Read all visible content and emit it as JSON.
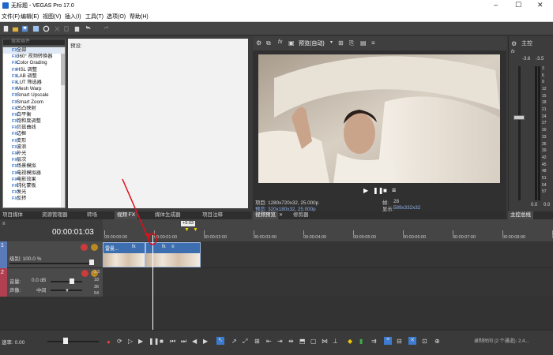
{
  "window": {
    "title": "无标题 - VEGAS Pro 17.0"
  },
  "menu": [
    "文件(F)",
    "编辑(E)",
    "视图(V)",
    "插入(I)",
    "工具(T)",
    "选项(O)",
    "帮助(H)"
  ],
  "explorer": {
    "search_placeholder": "搜索插件",
    "presets_label": "预设:",
    "fx_items": [
      "全部",
      "360° 视频转换器",
      "Color Grading",
      "HSL 调整",
      "LAB 调整",
      "LUT 筛选器",
      "Mesh Warp",
      "Smart Upscale",
      "Smart Zoom",
      "凹凸映射",
      "白平衡",
      "饱和度调整",
      "贝兹曲线",
      "边框",
      "变形",
      "波浪",
      "补光",
      "层次",
      "场景模拟",
      "电视模拟器",
      "电影效果",
      "钝化蒙板",
      "发光",
      "反转"
    ]
  },
  "bottom_tabs": [
    "项目媒体",
    "资源管理器",
    "转场",
    "视频 FX",
    "媒体生成器",
    "项目注释"
  ],
  "preview": {
    "quality": "预览(自动)",
    "project_info": "项目: 1280x720x32, 25.000p",
    "preview_info": "预览: 320x180x32, 25.000p",
    "frame_label": "帧:",
    "frame_value": "28",
    "display_label": "显示:",
    "display_value": "589x332x32",
    "tabs": [
      "视频预览",
      "修剪器"
    ]
  },
  "master": {
    "title": "主控",
    "levels": [
      "-3.6",
      "-3.5"
    ],
    "scale": [
      "3",
      "6",
      "9",
      "12",
      "15",
      "18",
      "21",
      "24",
      "27",
      "30",
      "33",
      "36",
      "39",
      "42",
      "45",
      "48",
      "51",
      "54",
      "57"
    ],
    "bottom_values": [
      "0.0",
      "0.0"
    ],
    "bus_label": "主控总线"
  },
  "timeline": {
    "timecode": "00:00:01:03",
    "cursor_box": "+5:03",
    "ruler": [
      "00:00:00:00",
      "00:00:01:00",
      "00:00:02:00",
      "00:00:03:00",
      "00:00:04:00",
      "00:00:05:00",
      "00:00:06:00",
      "00:00:07:00",
      "00:00:08:00",
      "00:00:09:00"
    ],
    "video_track": {
      "number": "1",
      "level_label": "级别: 100.0 %"
    },
    "audio_track": {
      "number": "2",
      "volume_label": "音量:",
      "volume_value": "0.0 dB",
      "pan_label": "声像:",
      "pan_value": "中间",
      "meter": [
        "-3.5",
        "18",
        "36",
        "54"
      ]
    },
    "clip_label": "雷曼..."
  },
  "status": {
    "rate_label": "速率: 0.00",
    "record_time": "录制时间 (2 个通道): 2,4..."
  },
  "colors": {
    "accent": "#3d6fb0",
    "playhead": "#ffffff",
    "annotation": "#e0101a"
  }
}
